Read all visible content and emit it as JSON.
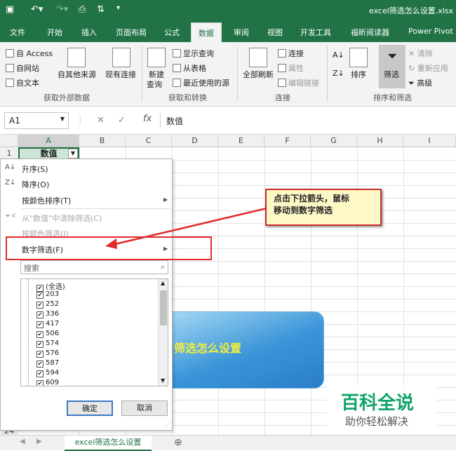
{
  "app": {
    "title": "excel筛选怎么设置.xlsx"
  },
  "tabs": [
    "文件",
    "开始",
    "插入",
    "页面布局",
    "公式",
    "数据",
    "审阅",
    "视图",
    "开发工具",
    "福昕阅读器",
    "Power Pivot"
  ],
  "ribbon": {
    "ext": {
      "access": "自 Access",
      "web": "自网站",
      "text": "自文本",
      "other": "自其他来源",
      "existing": "现有连接",
      "label": "获取外部数据"
    },
    "transform": {
      "newquery": "新建",
      "newquery2": "查询",
      "show": "显示查询",
      "table": "从表格",
      "recent": "最近使用的源",
      "label": "获取和转换"
    },
    "conn": {
      "refresh": "全部刷新",
      "connections": "连接",
      "props": "属性",
      "edit": "编辑链接",
      "label": "连接"
    },
    "sort": {
      "sort": "排序",
      "filter": "筛选",
      "clear": "清除",
      "reapply": "重新应用",
      "advanced": "高级",
      "label": "排序和筛选"
    }
  },
  "formula": {
    "namebox": "A1",
    "value": "数值"
  },
  "columns": [
    "A",
    "B",
    "C",
    "D",
    "E",
    "F",
    "G",
    "H",
    "I"
  ],
  "rows": [
    "1",
    "24"
  ],
  "cell_a1": "数值",
  "menu": {
    "asc": "升序(S)",
    "desc": "降序(O)",
    "colorsort": "按颜色排序(T)",
    "clear": "从\"数值\"中清除筛选(C)",
    "colorfilter": "按颜色筛选(I)",
    "numfilter": "数字筛选(F)",
    "search": "搜索",
    "items": [
      "(全选)",
      "203",
      "252",
      "336",
      "417",
      "506",
      "574",
      "576",
      "587",
      "594",
      "609"
    ],
    "ok": "确定",
    "cancel": "取消"
  },
  "promo": "筛选怎么设置",
  "callout": {
    "line1": "点击下拉箭头，鼠标",
    "line2": "移动到数字筛选"
  },
  "watermark": {
    "main": "百科全说",
    "sub": "助你轻松解决"
  },
  "sheet_tab": "excel筛选怎么设置"
}
